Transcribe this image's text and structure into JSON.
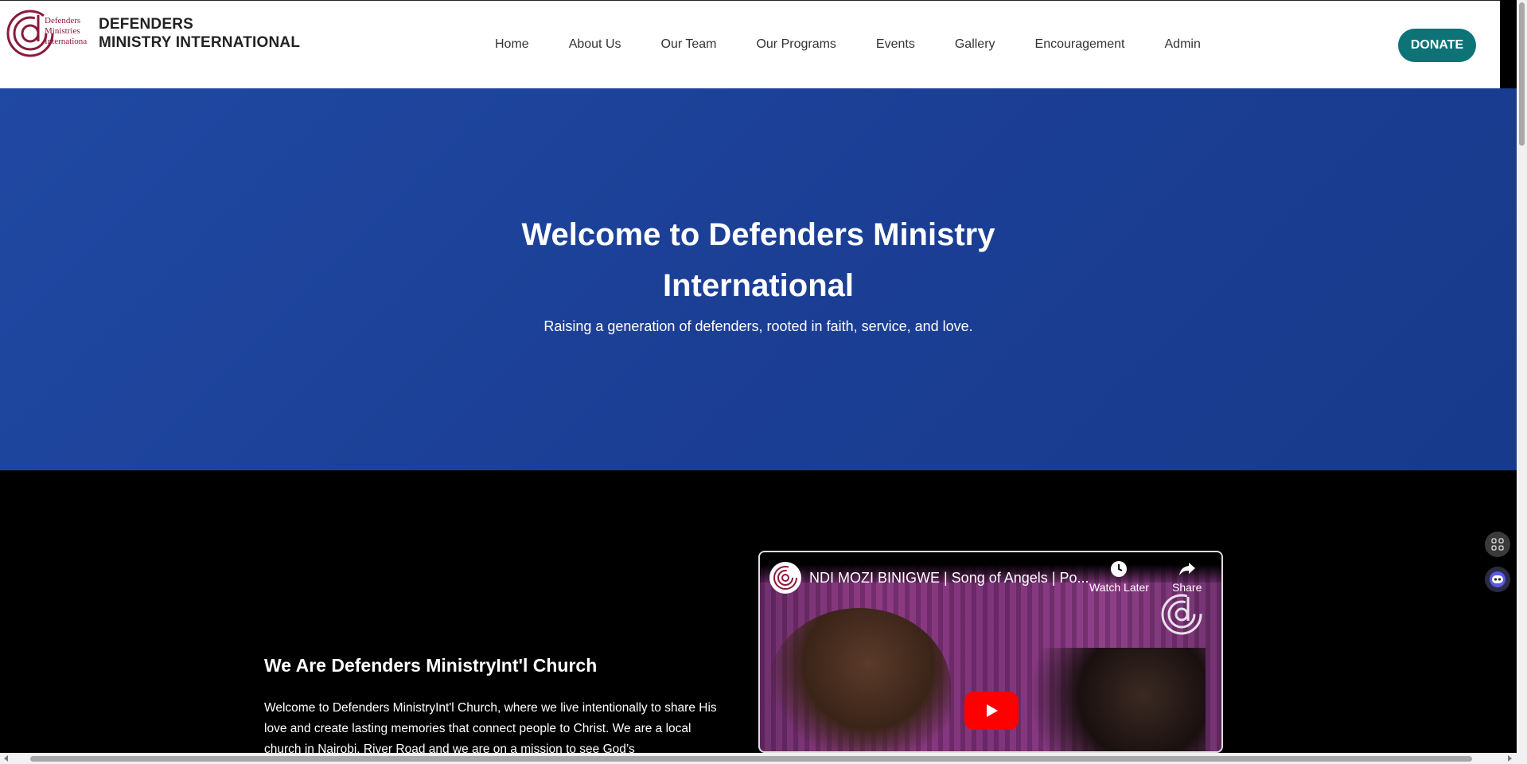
{
  "brand": {
    "line1": "DEFENDERS",
    "line2": "MINISTRY INTERNATIONAL",
    "logo_text": [
      "Defenders",
      "Ministries",
      "International"
    ]
  },
  "nav": {
    "items": [
      "Home",
      "About Us",
      "Our Team",
      "Our Programs",
      "Events",
      "Gallery",
      "Encouragement",
      "Admin"
    ],
    "donate_label": "DONATE"
  },
  "hero": {
    "title": "Welcome to Defenders Ministry International",
    "subtitle": "Raising a generation of defenders, rooted in faith, service, and love."
  },
  "about": {
    "heading": "We Are Defenders MinistryInt'l Church",
    "body": "Welcome to Defenders MinistryInt'l Church, where we live intentionally to share His love and create lasting memories that connect people to Christ. We are a local church in Nairobi, River Road and we are on a mission to see God’s"
  },
  "video": {
    "title": "NDI MOZI BINIGWE | Song of Angels | Po...",
    "watch_later": "Watch Later",
    "share": "Share"
  },
  "colors": {
    "hero_bg": "#1e44a0",
    "donate_bg": "#0d7377",
    "logo_accent": "#8b1a3a"
  }
}
